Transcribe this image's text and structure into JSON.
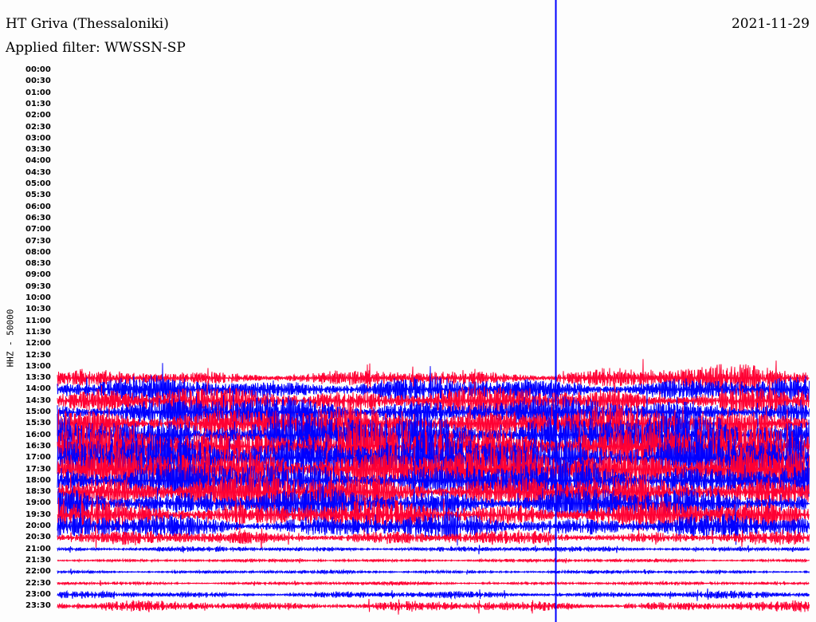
{
  "header": {
    "station": "HT Griva (Thessaloniki)",
    "filter": "Applied filter: WWSSN-SP",
    "date": "2021-11-29"
  },
  "chart_data": {
    "type": "line",
    "title": "HT Griva (Thessaloniki)",
    "ylabel": "HHZ - 50000",
    "xlabel": "",
    "row_labels": [
      "00:00",
      "00:30",
      "01:00",
      "01:30",
      "02:00",
      "02:30",
      "03:00",
      "03:30",
      "04:00",
      "04:30",
      "05:00",
      "05:30",
      "06:00",
      "06:30",
      "07:00",
      "07:30",
      "08:00",
      "08:30",
      "09:00",
      "09:30",
      "10:00",
      "10:30",
      "11:00",
      "11:30",
      "12:00",
      "12:30",
      "13:00",
      "13:30",
      "14:00",
      "14:30",
      "15:00",
      "15:30",
      "16:00",
      "16:30",
      "17:00",
      "17:30",
      "18:00",
      "18:30",
      "19:00",
      "19:30",
      "20:00",
      "20:30",
      "21:00",
      "21:30",
      "22:00",
      "22:30",
      "23:00",
      "23:30"
    ],
    "trace_colors": [
      "#0000ff",
      "#ff0033"
    ],
    "event_marker_minute": 19.9,
    "row_minutes": 30,
    "relative_amplitude": [
      0,
      0,
      0,
      0,
      0,
      0,
      0,
      0,
      0,
      0,
      0,
      0,
      0,
      0,
      0,
      0,
      0,
      0,
      0,
      0,
      0,
      0,
      0,
      0,
      0,
      0,
      0,
      9,
      14,
      16,
      18,
      20,
      26,
      28,
      30,
      28,
      24,
      22,
      18,
      16,
      14,
      8,
      3,
      2,
      2,
      2,
      4,
      6
    ]
  }
}
